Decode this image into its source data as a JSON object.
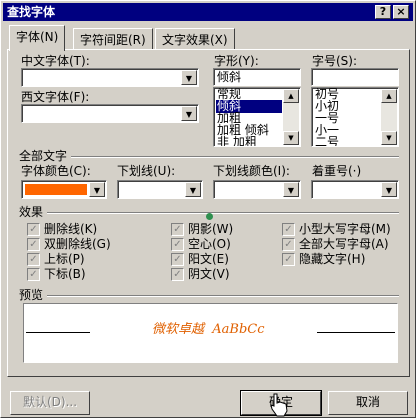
{
  "window": {
    "title": "查找字体",
    "help_label": "?",
    "close_label": "×"
  },
  "tabs": [
    {
      "label": "字体(N)",
      "active": true
    },
    {
      "label": "字符间距(R)",
      "active": false
    },
    {
      "label": "文字效果(X)",
      "active": false
    }
  ],
  "font": {
    "chinese_font_label": "中文字体(T):",
    "chinese_font_value": "",
    "western_font_label": "西文字体(F):",
    "western_font_value": "",
    "style_label": "字形(Y):",
    "style_value": "倾斜",
    "style_options": [
      "常规",
      "倾斜",
      "加粗",
      "加粗 倾斜",
      "非 加粗"
    ],
    "style_selected_index": 1,
    "size_label": "字号(S):",
    "size_value": "",
    "size_options": [
      "初号",
      "小初",
      "一号",
      "小一",
      "二号"
    ]
  },
  "all_text": {
    "group_label": "全部文字",
    "font_color_label": "字体颜色(C):",
    "font_color_value": "#ff6600",
    "underline_label": "下划线(U):",
    "underline_value": "",
    "underline_color_label": "下划线颜色(I):",
    "underline_color_value": "",
    "emphasis_label": "着重号(·)",
    "emphasis_value": ""
  },
  "effects": {
    "group_label": "效果",
    "items": [
      {
        "label": "删除线(K)",
        "checked": true
      },
      {
        "label": "双删除线(G)",
        "checked": true
      },
      {
        "label": "上标(P)",
        "checked": true
      },
      {
        "label": "下标(B)",
        "checked": true
      },
      {
        "label": "阴影(W)",
        "checked": true
      },
      {
        "label": "空心(O)",
        "checked": true
      },
      {
        "label": "阳文(E)",
        "checked": true
      },
      {
        "label": "阴文(V)",
        "checked": true
      },
      {
        "label": "小型大写字母(M)",
        "checked": true
      },
      {
        "label": "全部大写字母(A)",
        "checked": true
      },
      {
        "label": "隐藏文字(H)",
        "checked": true
      }
    ]
  },
  "preview": {
    "label": "预览",
    "sample_text": "微软卓越  AaBbCc",
    "sample_color": "#e06000"
  },
  "buttons": {
    "default_label": "默认(D)...",
    "ok_label": "确定",
    "cancel_label": "取消"
  }
}
